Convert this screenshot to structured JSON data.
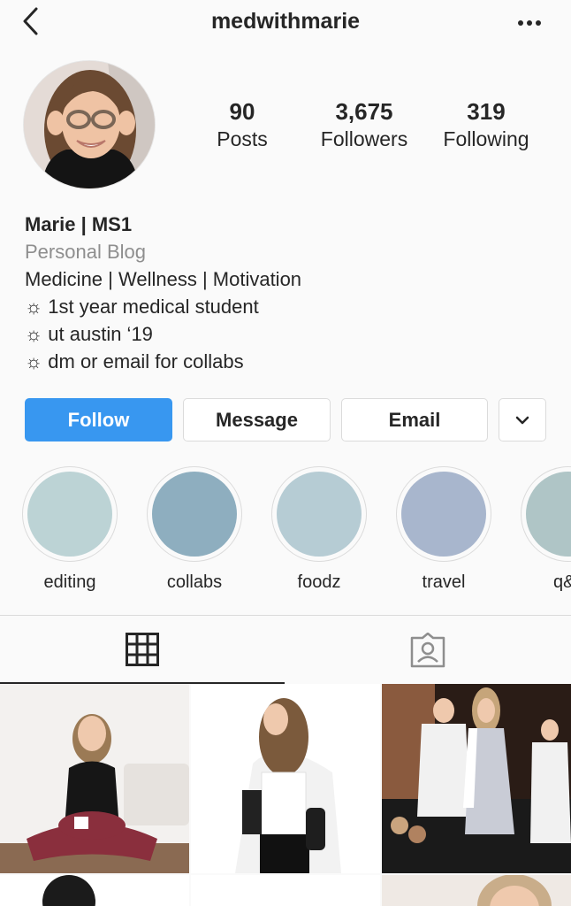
{
  "header": {
    "username": "medwithmarie",
    "back_icon": "chevron-left-icon",
    "more_icon": "more-dots-icon"
  },
  "stats": {
    "posts": {
      "value": "90",
      "label": "Posts"
    },
    "followers": {
      "value": "3,675",
      "label": "Followers"
    },
    "following": {
      "value": "319",
      "label": "Following"
    }
  },
  "bio": {
    "name": "Marie | MS1",
    "category": "Personal Blog",
    "line1": "Medicine | Wellness | Motivation",
    "line2": "☼ 1st year medical student",
    "line3": "☼ ut austin ‘19",
    "line4": "☼ dm or email for collabs"
  },
  "buttons": {
    "follow": "Follow",
    "message": "Message",
    "email": "Email",
    "more_icon": "chevron-down-icon"
  },
  "highlights": [
    {
      "label": "editing",
      "color": "#bcd3d5"
    },
    {
      "label": "collabs",
      "color": "#8eaebf"
    },
    {
      "label": "foodz",
      "color": "#b6ccd4"
    },
    {
      "label": "travel",
      "color": "#a8b6cd"
    },
    {
      "label": "q&",
      "color": "#afc5c6"
    }
  ],
  "tabs": {
    "grid_icon": "grid-icon",
    "tagged_icon": "tagged-icon"
  },
  "colors": {
    "accent": "#3897f0",
    "text": "#262626",
    "secondary": "#8e8e8e",
    "border": "#dbdbdb"
  }
}
